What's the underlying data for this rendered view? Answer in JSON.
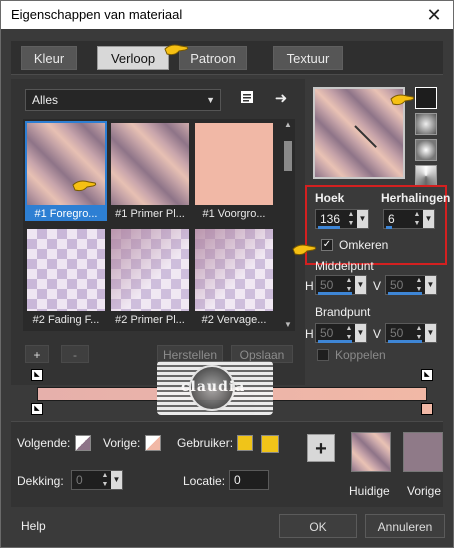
{
  "dialog": {
    "title": "Eigenschappen van materiaal",
    "close_symbol": "✕"
  },
  "tabs": [
    {
      "label": "Kleur",
      "active": false
    },
    {
      "label": "Verloop",
      "active": true
    },
    {
      "label": "Patroon",
      "active": false
    },
    {
      "label": "Textuur",
      "active": false
    }
  ],
  "library": {
    "dropdown_value": "Alles",
    "thumbnails": [
      {
        "label": "#1 Foregro...",
        "fill": "gradient",
        "selected": true
      },
      {
        "label": "#1 Primer Pl...",
        "fill": "gradient",
        "selected": false
      },
      {
        "label": "#1 Voorgro...",
        "fill": "solid",
        "selected": false
      },
      {
        "label": "#2 Fading F...",
        "fill": "checker",
        "selected": false
      },
      {
        "label": "#2 Primer Pl...",
        "fill": "checker",
        "selected": false
      },
      {
        "label": "#2 Vervage...",
        "fill": "checker",
        "selected": false
      }
    ],
    "add_label": "+",
    "remove_label": "-",
    "reset_label": "Herstellen",
    "save_label": "Opslaan"
  },
  "properties": {
    "angle_label": "Hoek",
    "angle_value": "136",
    "repeats_label": "Herhalingen",
    "repeats_value": "6",
    "invert_label": "Omkeren",
    "invert_checked": true,
    "center_label": "Middelpunt",
    "center_h_label": "H",
    "center_h_value": "50",
    "center_v_label": "V",
    "center_v_value": "50",
    "focal_label": "Brandpunt",
    "focal_h_label": "H",
    "focal_h_value": "50",
    "focal_v_label": "V",
    "focal_v_value": "50",
    "link_label": "Koppelen",
    "link_checked": false
  },
  "footer": {
    "next_label": "Volgende:",
    "prev_label": "Vorige:",
    "user_label": "Gebruiker:",
    "opacity_label": "Dekking:",
    "opacity_value": "0",
    "location_label": "Locatie:",
    "location_value": "0",
    "current_label": "Huidige",
    "previous_label": "Vorige",
    "help_label": "Help",
    "ok_label": "OK",
    "cancel_label": "Annuleren"
  },
  "watermark_text": "claudia",
  "colors": {
    "accent_blue": "#2d7fd3",
    "highlight_red": "#d42020",
    "gradient_dark": "#8e7488",
    "gradient_light": "#f1b8a6",
    "user_yellow": "#f0c419",
    "previous_swatch": "#8f7a88"
  }
}
